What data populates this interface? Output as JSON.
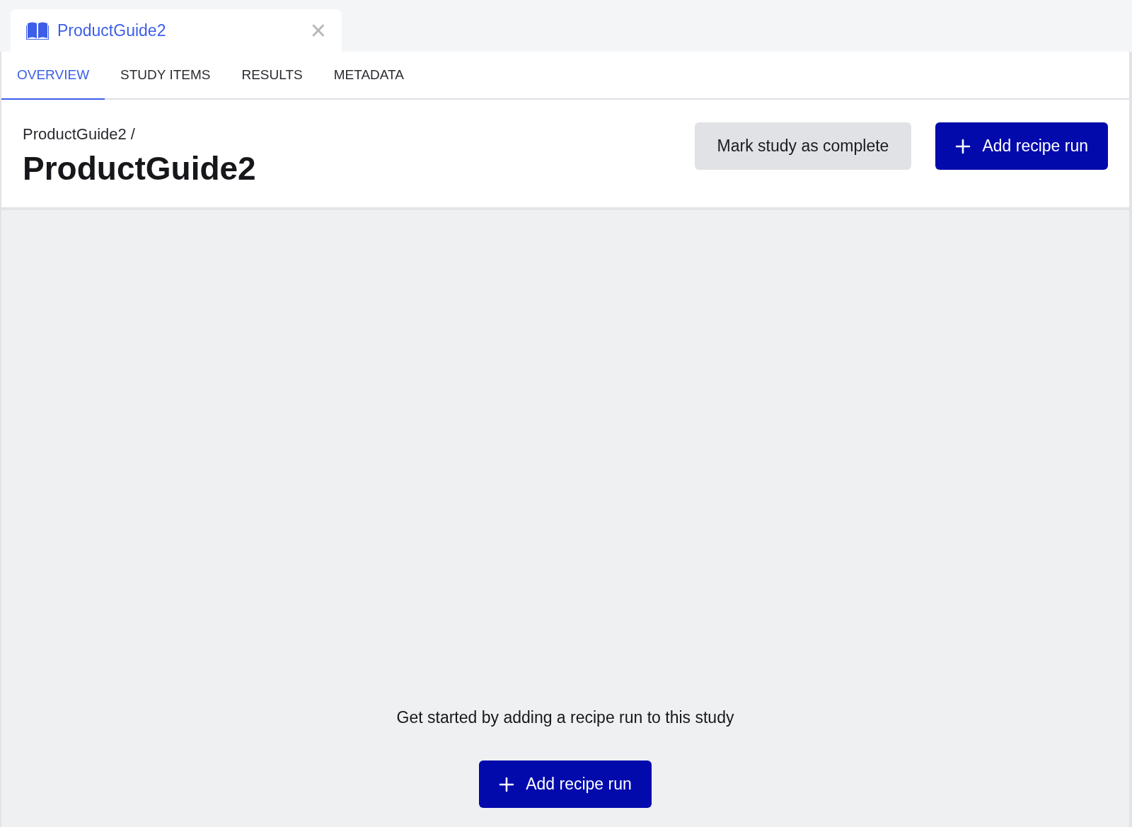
{
  "document_tab": {
    "title": "ProductGuide2",
    "close": "×"
  },
  "tabs": [
    {
      "label": "OVERVIEW",
      "selected": true
    },
    {
      "label": "STUDY ITEMS",
      "selected": false
    },
    {
      "label": "RESULTS",
      "selected": false
    },
    {
      "label": "METADATA",
      "selected": false
    }
  ],
  "header": {
    "breadcrumb": "ProductGuide2 /",
    "title": "ProductGuide2",
    "buttons": [
      {
        "label": "Mark study as complete",
        "kind": "secondary"
      },
      {
        "label": "Add recipe run",
        "kind": "primary"
      }
    ]
  },
  "empty_state": {
    "message": "Get started by adding a recipe run to this study",
    "button": {
      "label": "Add recipe run",
      "kind": "primary"
    }
  }
}
